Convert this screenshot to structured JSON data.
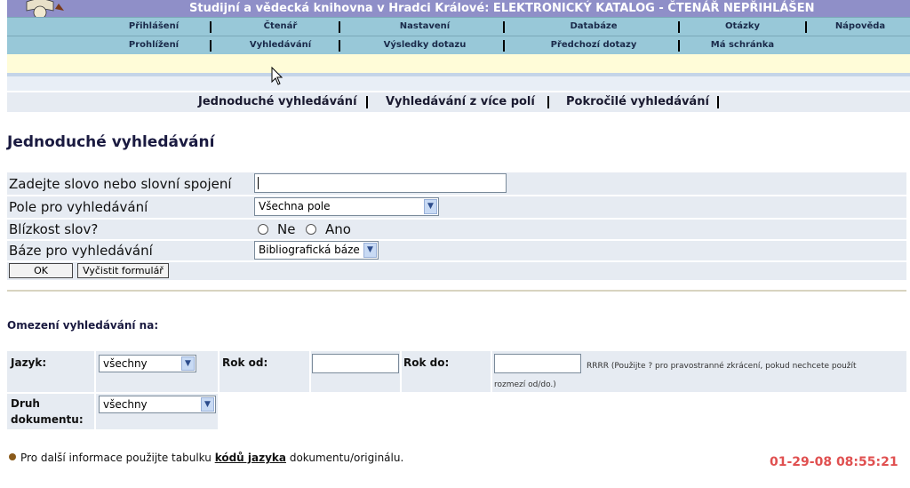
{
  "header": {
    "title": "Studijní a vědecká knihovna v Hradci Králové: ELEKTRONICKÝ KATALOG - ČTENÁŘ NEPŘIHLÁŠEN"
  },
  "nav_primary": [
    "Přihlášení",
    "Čtenář",
    "Nastavení",
    "Databáze",
    "Otázky",
    "Nápověda"
  ],
  "nav_secondary": [
    "Prohlížení",
    "Vyhledávání",
    "Výsledky dotazu",
    "Předchozí dotazy",
    "Má schránka"
  ],
  "search_tabs": [
    "Jednoduché vyhledávání",
    "Vyhledávání z více polí",
    "Pokročilé vyhledávání"
  ],
  "page_title": "Jednoduché vyhledávání",
  "form": {
    "word_label": "Zadejte slovo nebo slovní spojení",
    "word_value": "",
    "field_label": "Pole pro vyhledávání",
    "field_value": "Všechna pole",
    "proximity_label": "Blízkost slov?",
    "proximity_no": "Ne",
    "proximity_yes": "Ano",
    "base_label": "Báze pro vyhledávání",
    "base_value": "Bibliografická báze",
    "ok_button": "OK",
    "clear_button": "Vyčistit formulář"
  },
  "limits": {
    "title": "Omezení vyhledávání na:",
    "language_label": "Jazyk:",
    "language_value": "všechny",
    "year_from_label": "Rok od:",
    "year_to_label": "Rok do:",
    "year_from_value": "",
    "year_to_value": "",
    "year_hint_line1": "RRRR (Použijte ? pro pravostranné zkrácení, pokud nechcete použít",
    "year_hint_line2": "rozmezí od/do.)",
    "doctype_label_line1": "Druh",
    "doctype_label_line2": "dokumentu:",
    "doctype_value": "všechny"
  },
  "footer": {
    "note_before": "Pro další informace použijte tabulku",
    "note_link": "kódů jazyka",
    "note_after": "dokumentu/originálu.",
    "datetime": "01-29-08 08:55:21"
  },
  "colors": {
    "title_bar": "#8f8fc8",
    "nav_bar": "#98c8d8",
    "form_bg": "#e6ebf2",
    "datetime": "#e05050"
  }
}
